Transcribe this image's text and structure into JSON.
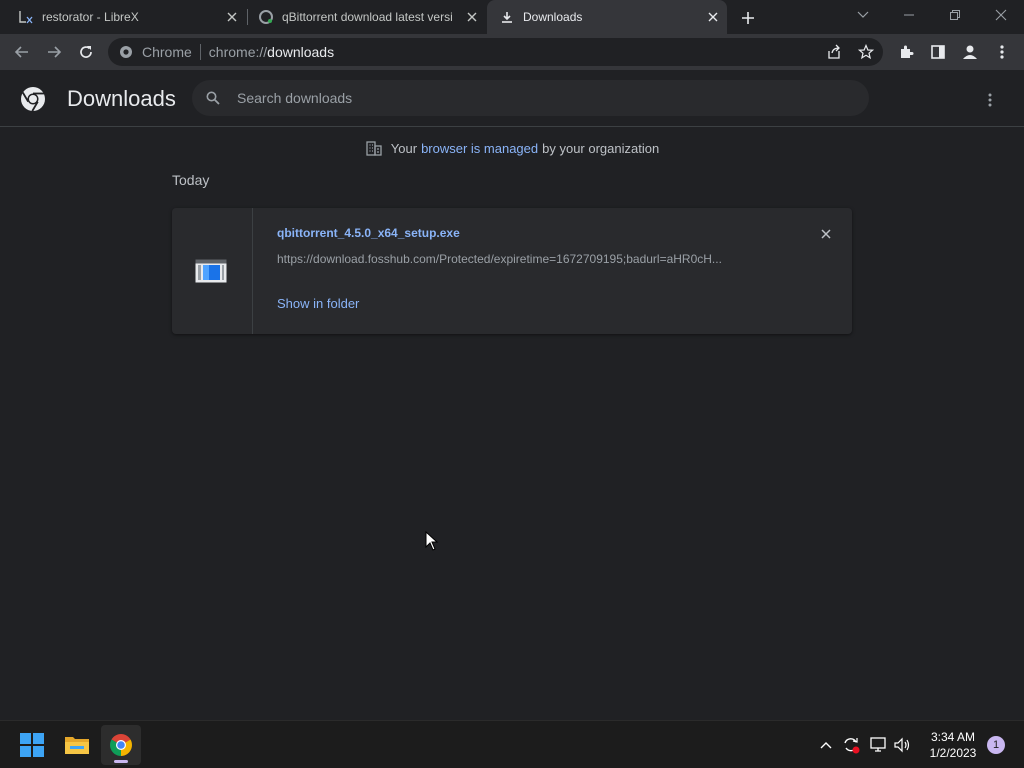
{
  "tabs": [
    {
      "title": "restorator - LibreX",
      "icon": "librex-icon"
    },
    {
      "title": "qBittorrent download latest versi",
      "icon": "fosshub-icon"
    },
    {
      "title": "Downloads",
      "icon": "download-icon"
    }
  ],
  "omnibox": {
    "chip": "Chrome",
    "url_scheme": "chrome://",
    "url_host": "downloads"
  },
  "page": {
    "title": "Downloads",
    "search_placeholder": "Search downloads",
    "managed_prefix": "Your",
    "managed_link": "browser is managed",
    "managed_suffix": "by your organization",
    "section_date": "Today"
  },
  "downloads": [
    {
      "filename": "qbittorrent_4.5.0_x64_setup.exe",
      "url": "https://download.fosshub.com/Protected/expiretime=1672709195;badurl=aHR0cH...",
      "action": "Show in folder"
    }
  ],
  "taskbar": {
    "time": "3:34 AM",
    "date": "1/2/2023",
    "notifications": "1"
  },
  "colors": {
    "accent": "#8ab4f8",
    "background": "#202124",
    "card": "#292a2d",
    "toolbar": "#35363a"
  }
}
